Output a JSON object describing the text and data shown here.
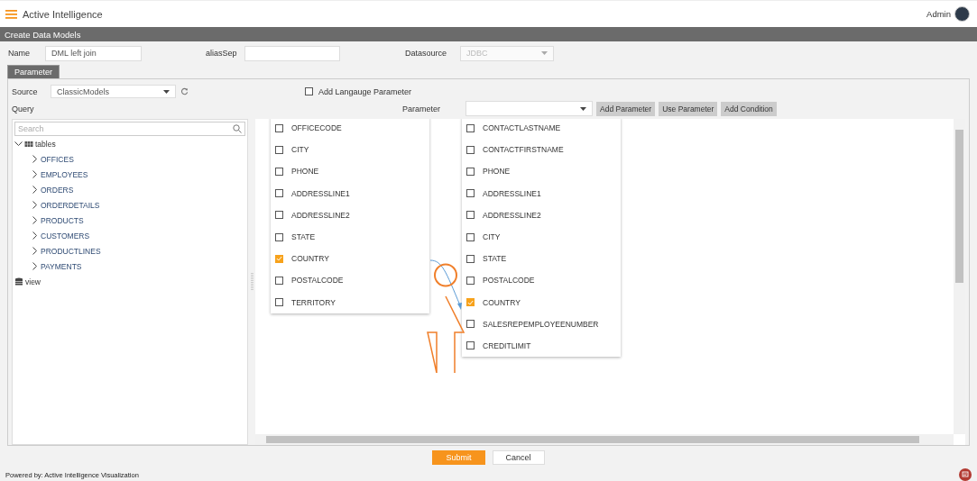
{
  "app": {
    "title": "Active Intelligence",
    "user": "Admin"
  },
  "page": {
    "title": "Create Data Models"
  },
  "form": {
    "name_label": "Name",
    "name_value": "DML left join",
    "alias_label": "aliasSep",
    "datasource_label": "Datasource",
    "datasource_value": "JDBC",
    "datasource_disabled": true
  },
  "tabs": [
    {
      "label": "Parameter",
      "selected": true
    }
  ],
  "source": {
    "label": "Source",
    "value": "ClassicModels"
  },
  "language_parameter": {
    "label": "Add Langauge Parameter",
    "checked": false
  },
  "query_label": "Query",
  "parameter": {
    "label": "Parameter"
  },
  "buttons": [
    "Add Parameter",
    "Use Parameter",
    "Add Condition"
  ],
  "search": {
    "placeholder": "Search"
  },
  "tree": [
    {
      "label": "tables",
      "kind": "table",
      "expanded": true,
      "children": [
        {
          "label": "OFFICES",
          "expanded": false
        },
        {
          "label": "EMPLOYEES",
          "expanded": false
        },
        {
          "label": "ORDERS",
          "expanded": false
        },
        {
          "label": "ORDERDETAILS",
          "expanded": false
        },
        {
          "label": "PRODUCTS",
          "expanded": false
        },
        {
          "label": "CUSTOMERS",
          "expanded": false
        },
        {
          "label": "PRODUCTLINES",
          "expanded": false
        },
        {
          "label": "PAYMENTS",
          "expanded": false
        }
      ]
    },
    {
      "label": "view",
      "kind": "database"
    }
  ],
  "table_boxes": [
    {
      "columns": [
        {
          "name": "OFFICECODE",
          "checked": false
        },
        {
          "name": "CITY",
          "checked": false
        },
        {
          "name": "PHONE",
          "checked": false
        },
        {
          "name": "ADDRESSLINE1",
          "checked": false
        },
        {
          "name": "ADDRESSLINE2",
          "checked": false
        },
        {
          "name": "STATE",
          "checked": false
        },
        {
          "name": "COUNTRY",
          "checked": true
        },
        {
          "name": "POSTALCODE",
          "checked": false
        },
        {
          "name": "TERRITORY",
          "checked": false
        }
      ]
    },
    {
      "columns": [
        {
          "name": "CONTACTLASTNAME",
          "checked": false
        },
        {
          "name": "CONTACTFIRSTNAME",
          "checked": false
        },
        {
          "name": "PHONE",
          "checked": false
        },
        {
          "name": "ADDRESSLINE1",
          "checked": false
        },
        {
          "name": "ADDRESSLINE2",
          "checked": false
        },
        {
          "name": "CITY",
          "checked": false
        },
        {
          "name": "STATE",
          "checked": false
        },
        {
          "name": "POSTALCODE",
          "checked": false
        },
        {
          "name": "COUNTRY",
          "checked": true
        },
        {
          "name": "SALESREPEMPLOYEENUMBER",
          "checked": false
        },
        {
          "name": "CREDITLIMIT",
          "checked": false
        }
      ]
    }
  ],
  "footer_buttons": [
    {
      "label": "Submit",
      "kind": "primary"
    },
    {
      "label": "Cancel",
      "kind": "secondary"
    }
  ],
  "powered_by": "Powered by: Active Intelligence Visualization"
}
